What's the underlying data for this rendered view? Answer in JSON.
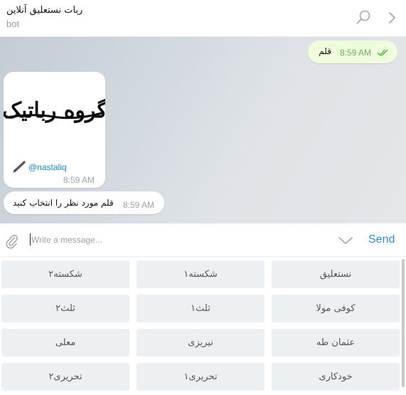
{
  "header": {
    "title": "ربات نستعلیق آنلاین",
    "subtitle": "bot",
    "icons": [
      "search-icon",
      "chevron-right-icon"
    ]
  },
  "messages": {
    "outgoing": {
      "text": "قلم",
      "time": "8:59 AM",
      "status_icon": "double-check-icon"
    },
    "media": {
      "image_text": "گروه رباتیک",
      "caption": "@nastaliq",
      "caption_icon": "pen-icon",
      "time": "8:59 AM"
    },
    "incoming": {
      "text": "قلم مورد نظر را انتخاب کنید",
      "time": "8:59 AM"
    }
  },
  "composer": {
    "placeholder": "Write a message...",
    "value": "",
    "send_label": "Send",
    "icons": [
      "paperclip-icon",
      "chevron-down-icon"
    ]
  },
  "keyboard": {
    "rows": [
      [
        "نستعلیق",
        "شکسته۱",
        "شکسته۲"
      ],
      [
        "کوفی مولا",
        "ثلث۱",
        "ثلث۲"
      ],
      [
        "عثمان طه",
        "نیریزی",
        "معلی"
      ],
      [
        "خودکاری",
        "تحریری۱",
        "تحریری۲"
      ]
    ]
  },
  "colors": {
    "accent": "#2e8bd0",
    "outgoing_bubble": "#effdde",
    "link": "#168acd",
    "keyboard_button": "#edf0f3"
  }
}
